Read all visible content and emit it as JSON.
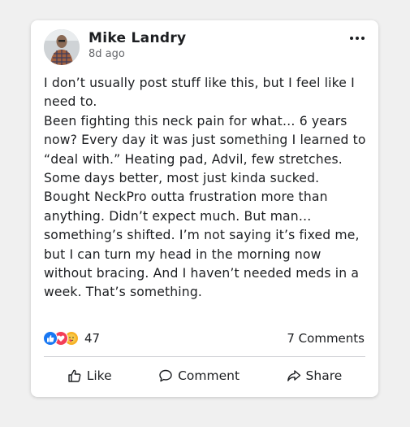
{
  "post": {
    "author": "Mike Landry",
    "time": "8d ago",
    "paragraphs": [
      "I don’t usually post stuff like this, but I feel like I need to.",
      "Been fighting this neck pain for what… 6 years now? Every day it was just something I learned to “deal with.” Heating pad, Advil, few stretches. Some days better, most just kinda sucked.",
      "Bought NeckPro outta frustration more than anything. Didn’t expect much. But man… something’s shifted. I’m not saying it’s fixed me, but I can turn my head in the morning now without bracing. And I haven’t needed meds in a week. That’s something."
    ]
  },
  "stats": {
    "reaction_count": "47",
    "comments": "7 Comments",
    "reaction_icons": [
      "like-icon",
      "love-icon",
      "care-icon"
    ]
  },
  "actions": {
    "like": "Like",
    "comment": "Comment",
    "share": "Share"
  },
  "colors": {
    "like": "#1877f2",
    "love": "#f33e58",
    "care": "#f7b125",
    "text": "#1c1e21",
    "muted": "#65676b"
  }
}
